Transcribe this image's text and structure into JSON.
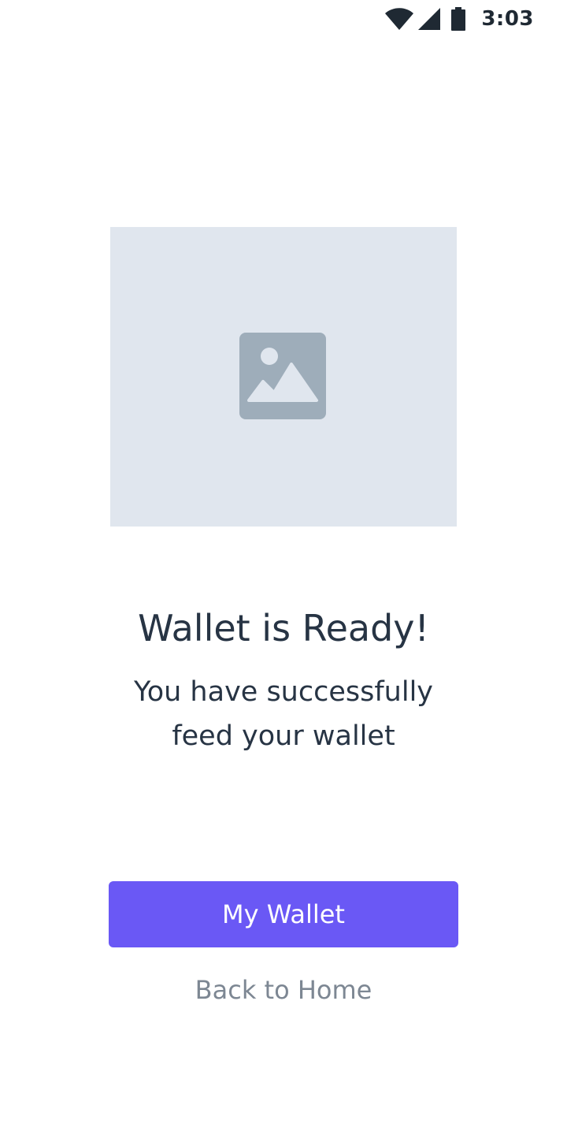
{
  "status_bar": {
    "time": "3:03",
    "icons": [
      "wifi-icon",
      "signal-icon",
      "battery-icon"
    ]
  },
  "illustration": {
    "icon": "image-placeholder-icon"
  },
  "content": {
    "title": "Wallet is Ready!",
    "subtitle": "You have successfully feed your wallet"
  },
  "actions": {
    "primary_label": "My Wallet",
    "secondary_label": "Back to Home"
  },
  "colors": {
    "accent": "#6a58f5",
    "text_primary": "#273444",
    "text_secondary": "#7d8793",
    "placeholder_bg": "#e0e6ee",
    "placeholder_icon": "#9eadba"
  }
}
